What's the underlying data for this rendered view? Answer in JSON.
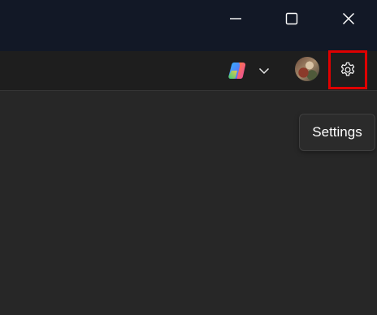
{
  "window_controls": {
    "minimize_icon": "minimize-icon",
    "maximize_icon": "maximize-icon",
    "close_icon": "close-icon"
  },
  "toolbar": {
    "copilot_icon": "copilot-icon",
    "dropdown_icon": "chevron-down-icon",
    "avatar": "profile-avatar",
    "settings_icon": "gear-icon"
  },
  "tooltip": {
    "text": "Settings"
  },
  "colors": {
    "titlebar": "#121826",
    "toolbar": "#1e1e1e",
    "content": "#272727",
    "highlight": "#e00000"
  }
}
